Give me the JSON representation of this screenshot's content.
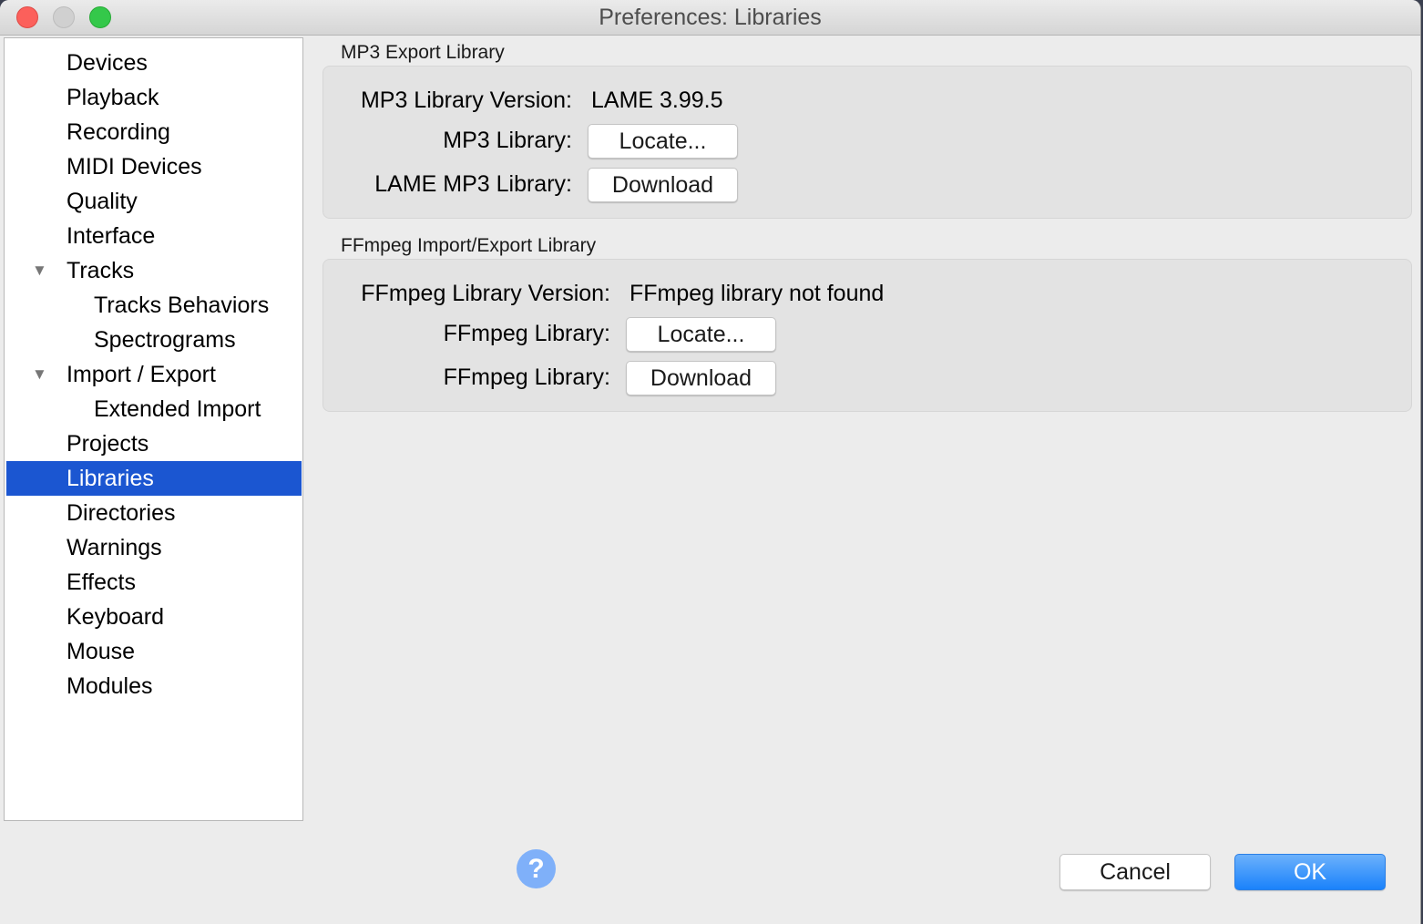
{
  "window": {
    "title": "Preferences: Libraries"
  },
  "sidebar": {
    "items": [
      {
        "label": "Devices",
        "level": 0
      },
      {
        "label": "Playback",
        "level": 0
      },
      {
        "label": "Recording",
        "level": 0
      },
      {
        "label": "MIDI Devices",
        "level": 0
      },
      {
        "label": "Quality",
        "level": 0
      },
      {
        "label": "Interface",
        "level": 0
      },
      {
        "label": "Tracks",
        "level": 0,
        "expanded": true
      },
      {
        "label": "Tracks Behaviors",
        "level": 1
      },
      {
        "label": "Spectrograms",
        "level": 1
      },
      {
        "label": "Import / Export",
        "level": 0,
        "expanded": true
      },
      {
        "label": "Extended Import",
        "level": 1
      },
      {
        "label": "Projects",
        "level": 0
      },
      {
        "label": "Libraries",
        "level": 0,
        "selected": true
      },
      {
        "label": "Directories",
        "level": 0
      },
      {
        "label": "Warnings",
        "level": 0
      },
      {
        "label": "Effects",
        "level": 0
      },
      {
        "label": "Keyboard",
        "level": 0
      },
      {
        "label": "Mouse",
        "level": 0
      },
      {
        "label": "Modules",
        "level": 0
      }
    ]
  },
  "mp3": {
    "group_title": "MP3 Export Library",
    "version_label": "MP3 Library Version:",
    "version_value": "LAME 3.99.5",
    "library_label": "MP3 Library:",
    "locate_button": "Locate...",
    "lame_label": "LAME MP3 Library:",
    "download_button": "Download"
  },
  "ffmpeg": {
    "group_title": "FFmpeg Import/Export Library",
    "version_label": "FFmpeg Library Version:",
    "version_value": "FFmpeg library not found",
    "library_label": "FFmpeg Library:",
    "locate_button": "Locate...",
    "download_label": "FFmpeg Library:",
    "download_button": "Download"
  },
  "footer": {
    "help_icon": "?",
    "cancel_button": "Cancel",
    "ok_button": "OK"
  },
  "colors": {
    "selection": "#1b56d1",
    "ok_button": "#1a82fb",
    "help_icon": "#7fb0f9"
  }
}
